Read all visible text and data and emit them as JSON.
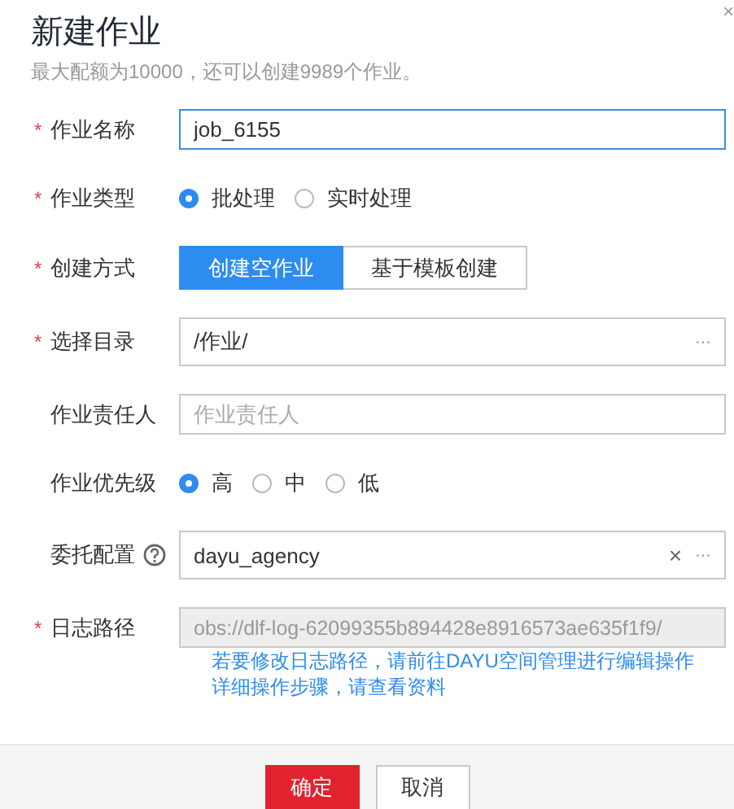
{
  "dialog": {
    "title": "新建作业",
    "quota_note": "最大配额为10000，还可以创建9989个作业。",
    "close": "×"
  },
  "fields": [
    {
      "kind": "text",
      "label": "作业名称",
      "required_mark": "*",
      "value": "job_6155",
      "focused": true
    },
    {
      "kind": "radio",
      "label": "作业类型",
      "required_mark": "*",
      "options": [
        {
          "label": "批处理",
          "selected": true
        },
        {
          "label": "实时处理",
          "selected": false
        }
      ]
    },
    {
      "kind": "segmented",
      "label": "创建方式",
      "required_mark": "*",
      "options": [
        {
          "label": "创建空作业",
          "selected": true
        },
        {
          "label": "基于模板创建",
          "selected": false
        }
      ]
    },
    {
      "kind": "picker",
      "label": "选择目录",
      "required_mark": "*",
      "value": "/作业/",
      "browse": "···"
    },
    {
      "kind": "text",
      "label": "作业责任人",
      "placeholder": "作业责任人",
      "focused": false
    },
    {
      "kind": "radio",
      "label": "作业优先级",
      "options": [
        {
          "label": "高",
          "selected": true
        },
        {
          "label": "中",
          "selected": false
        },
        {
          "label": "低",
          "selected": false
        }
      ]
    },
    {
      "kind": "picker",
      "label": "委托配置",
      "help": true,
      "value": "dayu_agency",
      "clear": "×",
      "browse": "···"
    },
    {
      "kind": "readonly",
      "label": "日志路径",
      "required_mark": "*",
      "value": "obs://dlf-log-62099355b894428e8916573ae635f1f9/",
      "hints": [
        "若要修改日志路径，请前往DAYU空间管理进行编辑操作",
        "详细操作步骤，请查看资料"
      ]
    }
  ],
  "buttons": [
    {
      "label": "确定",
      "primary": true
    },
    {
      "label": "取消",
      "primary": false
    }
  ]
}
